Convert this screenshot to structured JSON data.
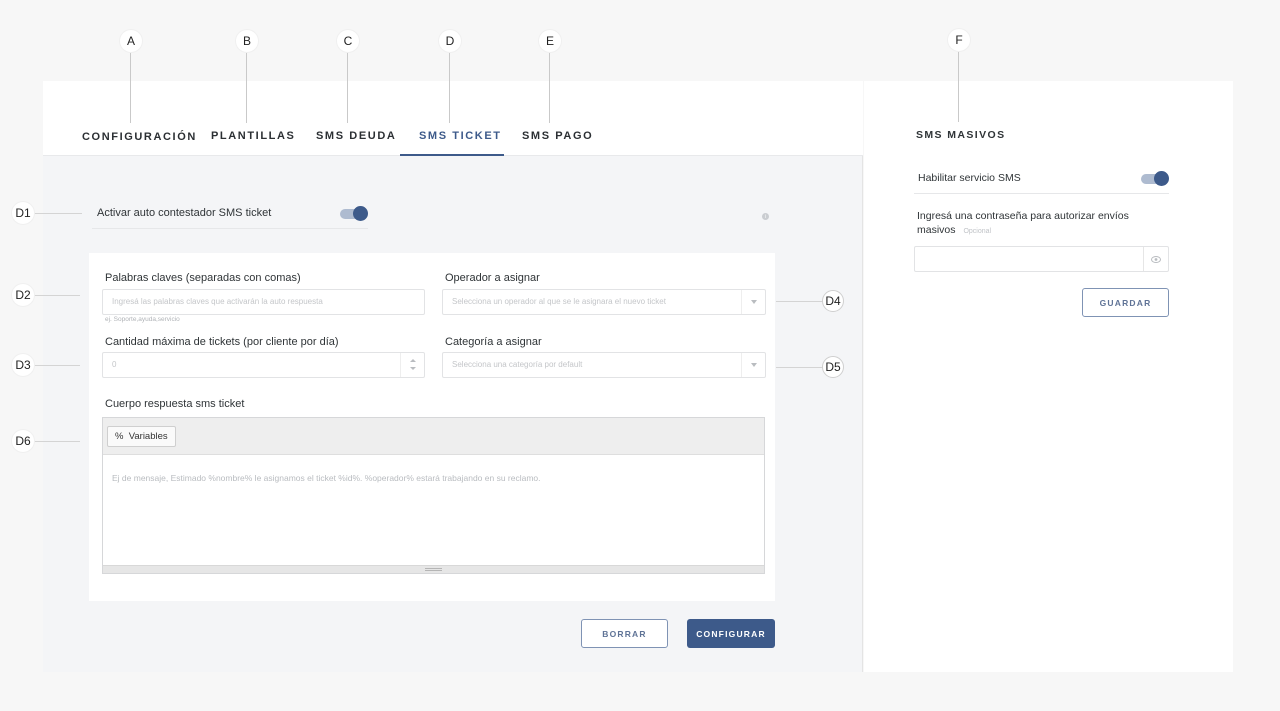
{
  "markers": {
    "A": "A",
    "B": "B",
    "C": "C",
    "D": "D",
    "E": "E",
    "F": "F",
    "D1": "D1",
    "D2": "D2",
    "D3": "D3",
    "D4": "D4",
    "D5": "D5",
    "D6": "D6"
  },
  "tabs": [
    {
      "label": "CONFIGURACIÓN"
    },
    {
      "label": "PLANTILLAS"
    },
    {
      "label": "SMS DEUDA"
    },
    {
      "label": "SMS TICKET",
      "active": true
    },
    {
      "label": "SMS PAGO"
    }
  ],
  "auto_reply": {
    "label": "Activar auto contestador SMS ticket",
    "enabled": true
  },
  "form": {
    "keywords": {
      "label": "Palabras claves (separadas con comas)",
      "placeholder": "Ingresá las palabras claves que activarán la auto respuesta",
      "hint": "ej. Soporte,ayuda,servicio"
    },
    "operator": {
      "label": "Operador a asignar",
      "placeholder": "Selecciona un operador al que se le asignara el nuevo ticket"
    },
    "max_tickets": {
      "label": "Cantidad máxima de tickets (por cliente por día)",
      "placeholder": "0"
    },
    "category": {
      "label": "Categoría a asignar",
      "placeholder": "Selecciona una categoría por default"
    },
    "body": {
      "label": "Cuerpo respuesta sms ticket",
      "variables_button": "Variables",
      "variables_symbol": "%",
      "placeholder": "Ej de mensaje, Estimado %nombre% le asignamos el ticket  %id%. %operador% estará trabajando en su reclamo."
    }
  },
  "actions": {
    "clear": "BORRAR",
    "configure": "CONFIGURAR"
  },
  "mass_sms": {
    "title": "SMS MASIVOS",
    "enable_label": "Habilitar servicio SMS",
    "enabled": true,
    "password_label": "Ingresá una contraseña para autorizar envíos masivos",
    "optional_label": "Opcional",
    "save": "GUARDAR"
  },
  "colors": {
    "accent": "#3d5a8a",
    "accent_light": "#aebbd0"
  }
}
